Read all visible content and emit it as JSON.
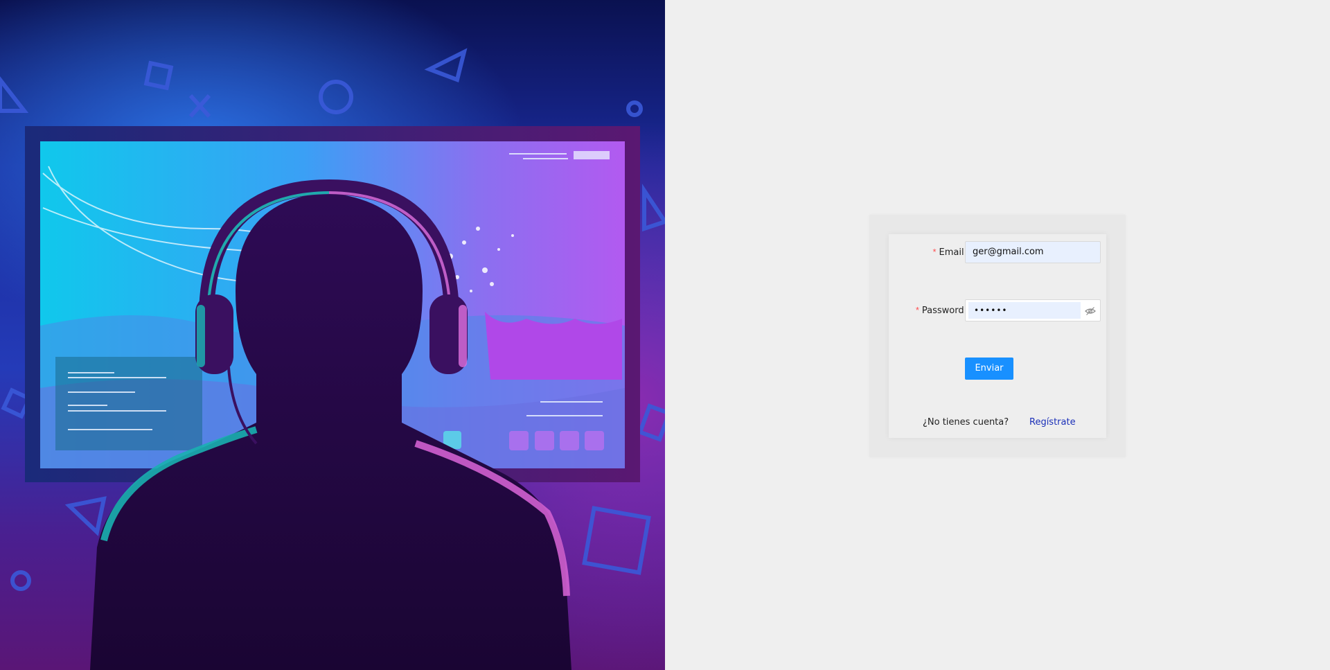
{
  "hero": {
    "colors": {
      "deep": "#0a1150",
      "blue": "#243bb8",
      "cyan": "#2fd6f0",
      "magenta": "#c85cff",
      "silhouette": "#2a0a4a"
    }
  },
  "form": {
    "email": {
      "label": "Email",
      "value": "ger@gmail.com"
    },
    "password": {
      "label": "Password",
      "masked_value": "••••••",
      "toggle_icon": "eye-invisible-icon"
    },
    "submit_label": "Enviar",
    "signup_prompt": "¿No tienes cuenta?",
    "signup_link": "Regístrate",
    "required_mark": "*",
    "colon": ":"
  },
  "colors": {
    "primary": "#1890ff",
    "required": "#ff4d4f",
    "autofill": "#e8f0fe",
    "link": "#1a2fb8",
    "page_bg": "#efefef"
  }
}
